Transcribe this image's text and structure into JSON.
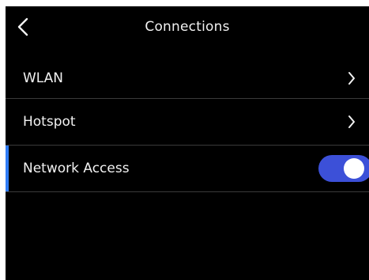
{
  "header": {
    "title": "Connections",
    "back_icon": "chevron-left-icon"
  },
  "connections": {
    "items": [
      {
        "label": "WLAN",
        "control": "chevron-right-icon"
      },
      {
        "label": "Hotspot",
        "control": "chevron-right-icon"
      },
      {
        "label": "Network Access",
        "control": "toggle",
        "toggle_on": true,
        "selected": true
      }
    ]
  },
  "colors": {
    "background": "#000000",
    "text": "#f2f2f2",
    "divider": "#3a3a3a",
    "selected_indicator": "#2f7cf6",
    "toggle_on": "#3c50d8",
    "toggle_knob": "#ffffff"
  }
}
